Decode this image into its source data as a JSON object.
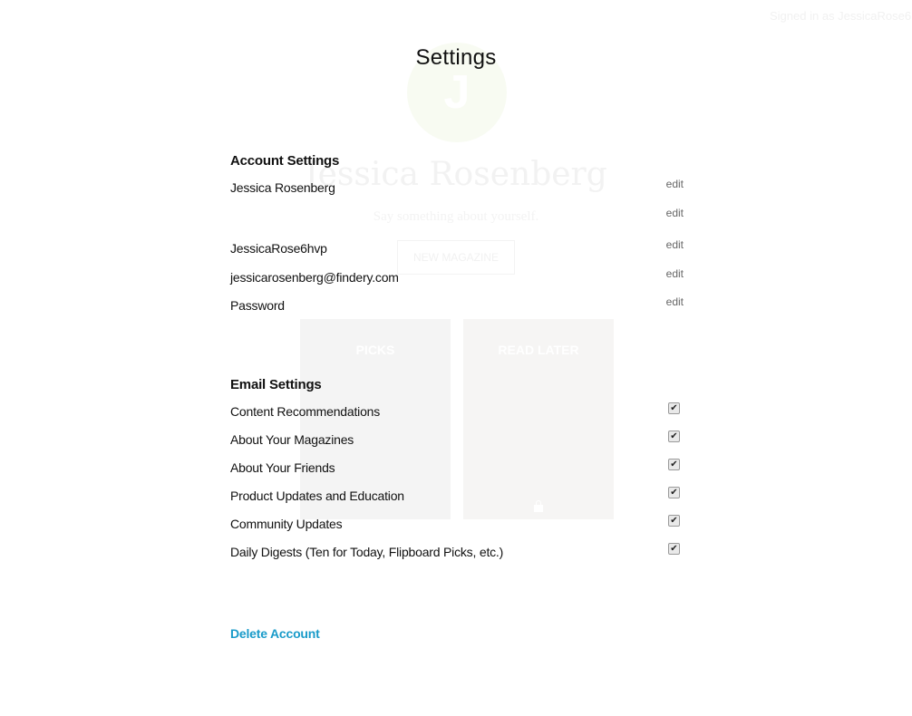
{
  "background": {
    "signed_in_text": "Signed in as JessicaRose6",
    "avatar_initial": "J",
    "profile_name": "Jessica Rosenberg",
    "bio_placeholder": "Say something about yourself.",
    "new_magazine_label": "NEW MAGAZINE",
    "tiles": [
      {
        "label": "PICKS"
      },
      {
        "label": "READ LATER",
        "icon": "lock-icon"
      }
    ]
  },
  "page_title": "Settings",
  "account_settings": {
    "heading": "Account Settings",
    "rows": [
      {
        "label": "Jessica Rosenberg",
        "action": "edit"
      },
      {
        "label": "",
        "action": "edit"
      },
      {
        "label": "JessicaRose6hvp",
        "action": "edit"
      },
      {
        "label": "jessicarosenberg@findery.com",
        "action": "edit"
      },
      {
        "label": "Password",
        "action": "edit"
      }
    ]
  },
  "email_settings": {
    "heading": "Email Settings",
    "options": [
      {
        "label": "Content Recommendations",
        "checked": true,
        "mark": "✔"
      },
      {
        "label": "About Your Magazines",
        "checked": true,
        "mark": "✔"
      },
      {
        "label": "About Your Friends",
        "checked": true,
        "mark": "✔"
      },
      {
        "label": "Product Updates and Education",
        "checked": true,
        "mark": "✔"
      },
      {
        "label": "Community Updates",
        "checked": true,
        "mark": "✔"
      },
      {
        "label": "Daily Digests (Ten for Today, Flipboard Picks, etc.)",
        "checked": true,
        "mark": "✔"
      }
    ]
  },
  "delete_account_label": "Delete Account",
  "colors": {
    "link": "#1a9bc9",
    "edit": "#666666"
  }
}
